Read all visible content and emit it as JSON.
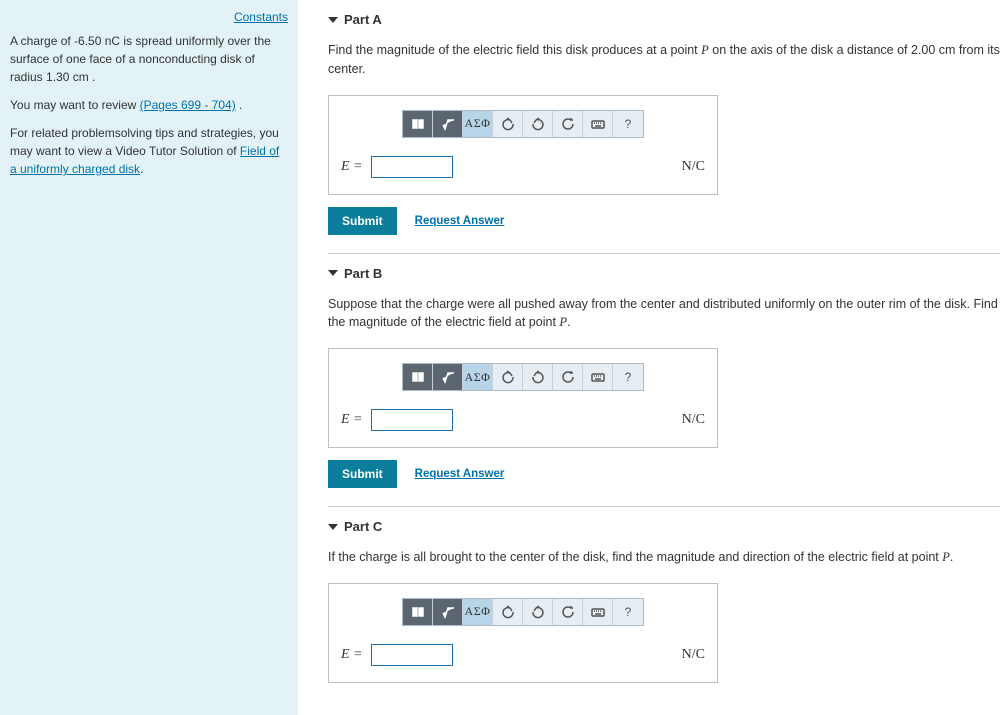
{
  "sidebar": {
    "constants_link": "Constants",
    "problem_text_1": "A charge of -6.50 nC is spread uniformly over the surface of one face of a nonconducting disk of radius 1.30 cm .",
    "review_prefix": "You may want to review ",
    "review_link": "(Pages 699 - 704)",
    "review_suffix": " .",
    "tips_prefix": "For related problemsolving tips and strategies, you may want to view a Video Tutor Solution of ",
    "tips_link": "Field of a uniformly charged disk",
    "tips_suffix": "."
  },
  "toolbar": {
    "greek": "ΑΣΦ",
    "help": "?"
  },
  "common": {
    "label": "E =",
    "unit": "N/C",
    "submit": "Submit",
    "request": "Request Answer"
  },
  "parts": {
    "a": {
      "title": "Part A",
      "prompt_pre": "Find the magnitude of the electric field this disk produces at a point ",
      "prompt_var": "P",
      "prompt_post": " on the axis of the disk a distance of 2.00 cm from its center."
    },
    "b": {
      "title": "Part B",
      "prompt_pre": "Suppose that the charge were all pushed away from the center and distributed uniformly on the outer rim of the disk. Find the magnitude of the electric field at point ",
      "prompt_var": "P",
      "prompt_post": "."
    },
    "c": {
      "title": "Part C",
      "prompt_pre": "If the charge is all brought to the center of the disk, find the magnitude and direction of the electric field at point ",
      "prompt_var": "P",
      "prompt_post": "."
    }
  }
}
